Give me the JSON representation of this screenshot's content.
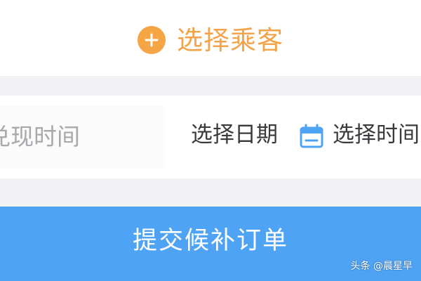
{
  "passenger": {
    "label": "选择乘客",
    "icon": "plus-circle-icon",
    "color": "#f6a545"
  },
  "time": {
    "field_label": "兑现时间",
    "date_label": "选择日期",
    "date_icon": "calendar-icon",
    "time_label": "选择时间"
  },
  "submit": {
    "label": "提交候补订单",
    "color": "#4fa3f5"
  },
  "watermark": {
    "text": "头条 @晨星早"
  }
}
